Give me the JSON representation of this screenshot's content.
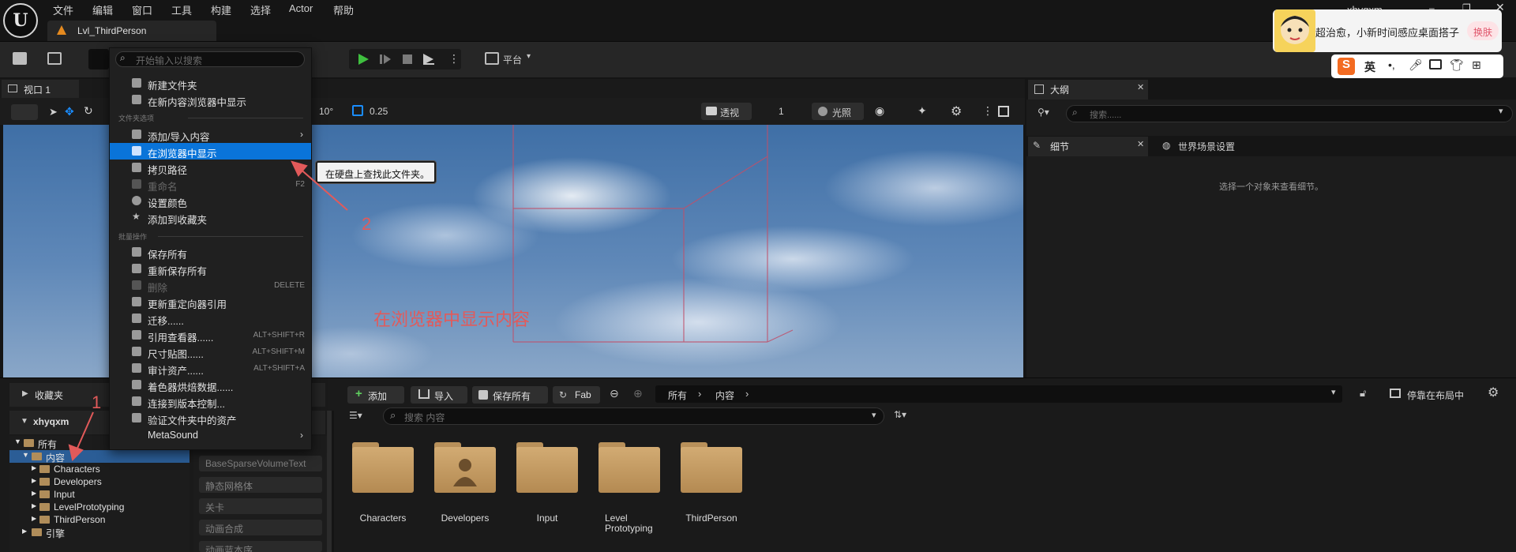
{
  "menubar": {
    "items": [
      "文件",
      "编辑",
      "窗口",
      "工具",
      "构建",
      "选择",
      "Actor",
      "帮助"
    ],
    "level_tab": "Lvl_ThirdPerson",
    "user": "xhyqxm"
  },
  "toolbar": {
    "platform": "平台"
  },
  "viewport": {
    "tab": "视口 1",
    "snap_angle": "10°",
    "snap_scale": "0.25",
    "view_mode": "透视",
    "lit_mode": "光照",
    "cam_speed": "1",
    "annotation": "在浏览器中显示内容"
  },
  "outliner": {
    "tab": "大纲",
    "search_placeholder": "搜索......"
  },
  "details": {
    "tab": "细节",
    "tab2": "世界场景设置",
    "hint": "选择一个对象来查看细节。"
  },
  "context_menu": {
    "search_placeholder": "开始输入以搜索",
    "section_folder": "文件夹选项",
    "section_bulk": "批量操作",
    "items": [
      {
        "label": "新建文件夹",
        "shortcut": ""
      },
      {
        "label": "在新内容浏览器中显示",
        "shortcut": ""
      },
      {
        "label": "添加/导入内容",
        "shortcut": ""
      },
      {
        "label": "在浏览器中显示",
        "shortcut": ""
      },
      {
        "label": "拷贝路径",
        "shortcut": ""
      },
      {
        "label": "重命名",
        "shortcut": "F2"
      },
      {
        "label": "设置颜色",
        "shortcut": ""
      },
      {
        "label": "添加到收藏夹",
        "shortcut": ""
      },
      {
        "label": "保存所有",
        "shortcut": ""
      },
      {
        "label": "重新保存所有",
        "shortcut": ""
      },
      {
        "label": "删除",
        "shortcut": "DELETE"
      },
      {
        "label": "更新重定向器引用",
        "shortcut": ""
      },
      {
        "label": "迁移......",
        "shortcut": ""
      },
      {
        "label": "引用查看器......",
        "shortcut": "ALT+SHIFT+R"
      },
      {
        "label": "尺寸贴图......",
        "shortcut": "ALT+SHIFT+M"
      },
      {
        "label": "审计资产......",
        "shortcut": "ALT+SHIFT+A"
      },
      {
        "label": "着色器烘焙数据......",
        "shortcut": ""
      },
      {
        "label": "连接到版本控制...",
        "shortcut": ""
      },
      {
        "label": "验证文件夹中的资产",
        "shortcut": ""
      },
      {
        "label": "MetaSound",
        "shortcut": ""
      }
    ],
    "tooltip": "在硬盘上查找此文件夹。"
  },
  "annotations": {
    "one": "1",
    "two": "2"
  },
  "content_browser": {
    "favorites": "收藏夹",
    "project": "xhyqxm",
    "tree": [
      "所有",
      "内容",
      "Characters",
      "Developers",
      "Input",
      "LevelPrototyping",
      "ThirdPerson",
      "引擎"
    ],
    "filters": [
      "BaseSparseVolumeText",
      "静态网格体",
      "关卡",
      "动画合成",
      "动画蓝本序"
    ],
    "buttons": {
      "add": "添加",
      "import": "导入",
      "save_all": "保存所有",
      "fab": "Fab"
    },
    "breadcrumb": [
      "所有",
      "内容"
    ],
    "search_placeholder": "搜索 内容",
    "dock_label": "停靠在布局中",
    "assets": [
      "Characters",
      "Developers",
      "Input",
      "Level Prototyping",
      "ThirdPerson"
    ]
  },
  "ime": {
    "message": "超治愈，小新时间感应桌面搭子",
    "switch": "换肤",
    "lang": "英"
  },
  "colors": {
    "accent": "#0a74d9",
    "annotation": "#e25a5a",
    "folder": "#c9a36b"
  }
}
